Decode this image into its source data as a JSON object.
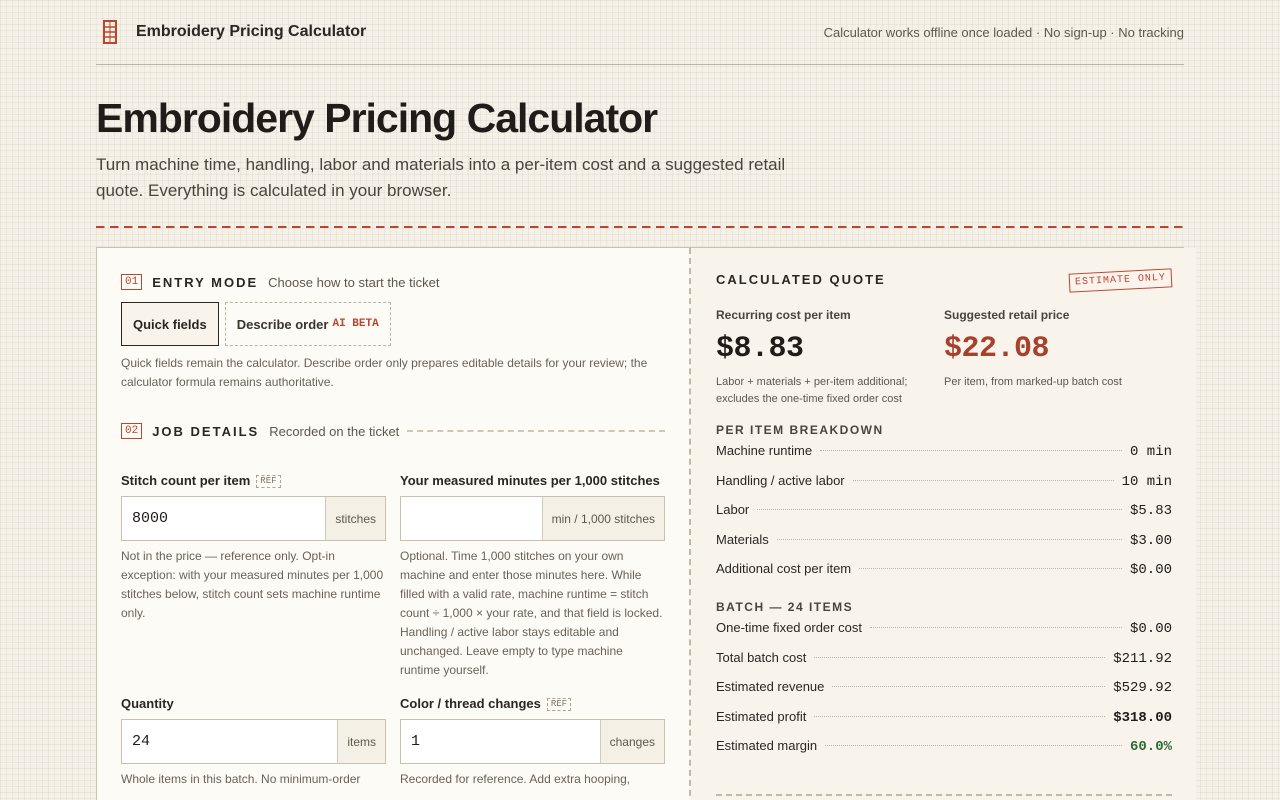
{
  "header": {
    "brand": "Embroidery Pricing Calculator",
    "tagline": "Calculator works offline once loaded · No sign-up · No tracking"
  },
  "page": {
    "title": "Embroidery Pricing Calculator",
    "lede": "Turn machine time, handling, labor and materials into a per-item cost and a suggested retail quote. Everything is calculated in your browser."
  },
  "entry_mode": {
    "num": "01",
    "title": "ENTRY MODE",
    "subtitle": "Choose how to start the ticket",
    "quick_label": "Quick fields",
    "describe_label": "Describe order",
    "beta_label": "AI BETA",
    "help": "Quick fields remain the calculator. Describe order only prepares editable details for your review; the calculator formula remains authoritative."
  },
  "job_details": {
    "num": "02",
    "title": "JOB DETAILS",
    "subtitle": "Recorded on the ticket",
    "stitch": {
      "label": "Stitch count per item",
      "badge": "REF",
      "value": "8000",
      "unit": "stitches",
      "help": "Not in the price — reference only. Opt-in exception: with your measured minutes per 1,000 stitches below, stitch count sets machine runtime only."
    },
    "minutes": {
      "label": "Your measured minutes per 1,000 stitches",
      "value": "",
      "unit": "min / 1,000 stitches",
      "help": "Optional. Time 1,000 stitches on your own machine and enter those minutes here. While filled with a valid rate, machine runtime = stitch count ÷ 1,000 × your rate, and that field is locked. Handling / active labor stays editable and unchanged. Leave empty to type machine runtime yourself."
    },
    "quantity": {
      "label": "Quantity",
      "value": "24",
      "unit": "items",
      "help": "Whole items in this batch. No minimum-order"
    },
    "color": {
      "label": "Color / thread changes",
      "badge": "REF",
      "value": "1",
      "unit": "changes",
      "help": "Recorded for reference. Add extra hooping,"
    }
  },
  "quote": {
    "title": "CALCULATED QUOTE",
    "stamp": "ESTIMATE ONLY",
    "recurring_label": "Recurring cost per item",
    "recurring_value": "$8.83",
    "recurring_note": "Labor + materials + per-item additional; excludes the one-time fixed order cost",
    "retail_label": "Suggested retail price",
    "retail_value": "$22.08",
    "retail_note": "Per item, from marked-up batch cost",
    "breakdown_title": "PER ITEM BREAKDOWN",
    "breakdown": [
      {
        "label": "Machine runtime",
        "value": "0 min"
      },
      {
        "label": "Handling / active labor",
        "value": "10 min"
      },
      {
        "label": "Labor",
        "value": "$5.83"
      },
      {
        "label": "Materials",
        "value": "$3.00"
      },
      {
        "label": "Additional cost per item",
        "value": "$0.00"
      }
    ],
    "batch_title": "BATCH — 24 ITEMS",
    "batch": [
      {
        "label": "One-time fixed order cost",
        "value": "$0.00"
      },
      {
        "label": "Total batch cost",
        "value": "$211.92"
      },
      {
        "label": "Estimated revenue",
        "value": "$529.92"
      },
      {
        "label": "Estimated profit",
        "value": "$318.00"
      },
      {
        "label": "Estimated margin",
        "value": "60.0%"
      }
    ]
  },
  "colors": {
    "accent": "#b8472f",
    "positive": "#2f6b3a"
  }
}
